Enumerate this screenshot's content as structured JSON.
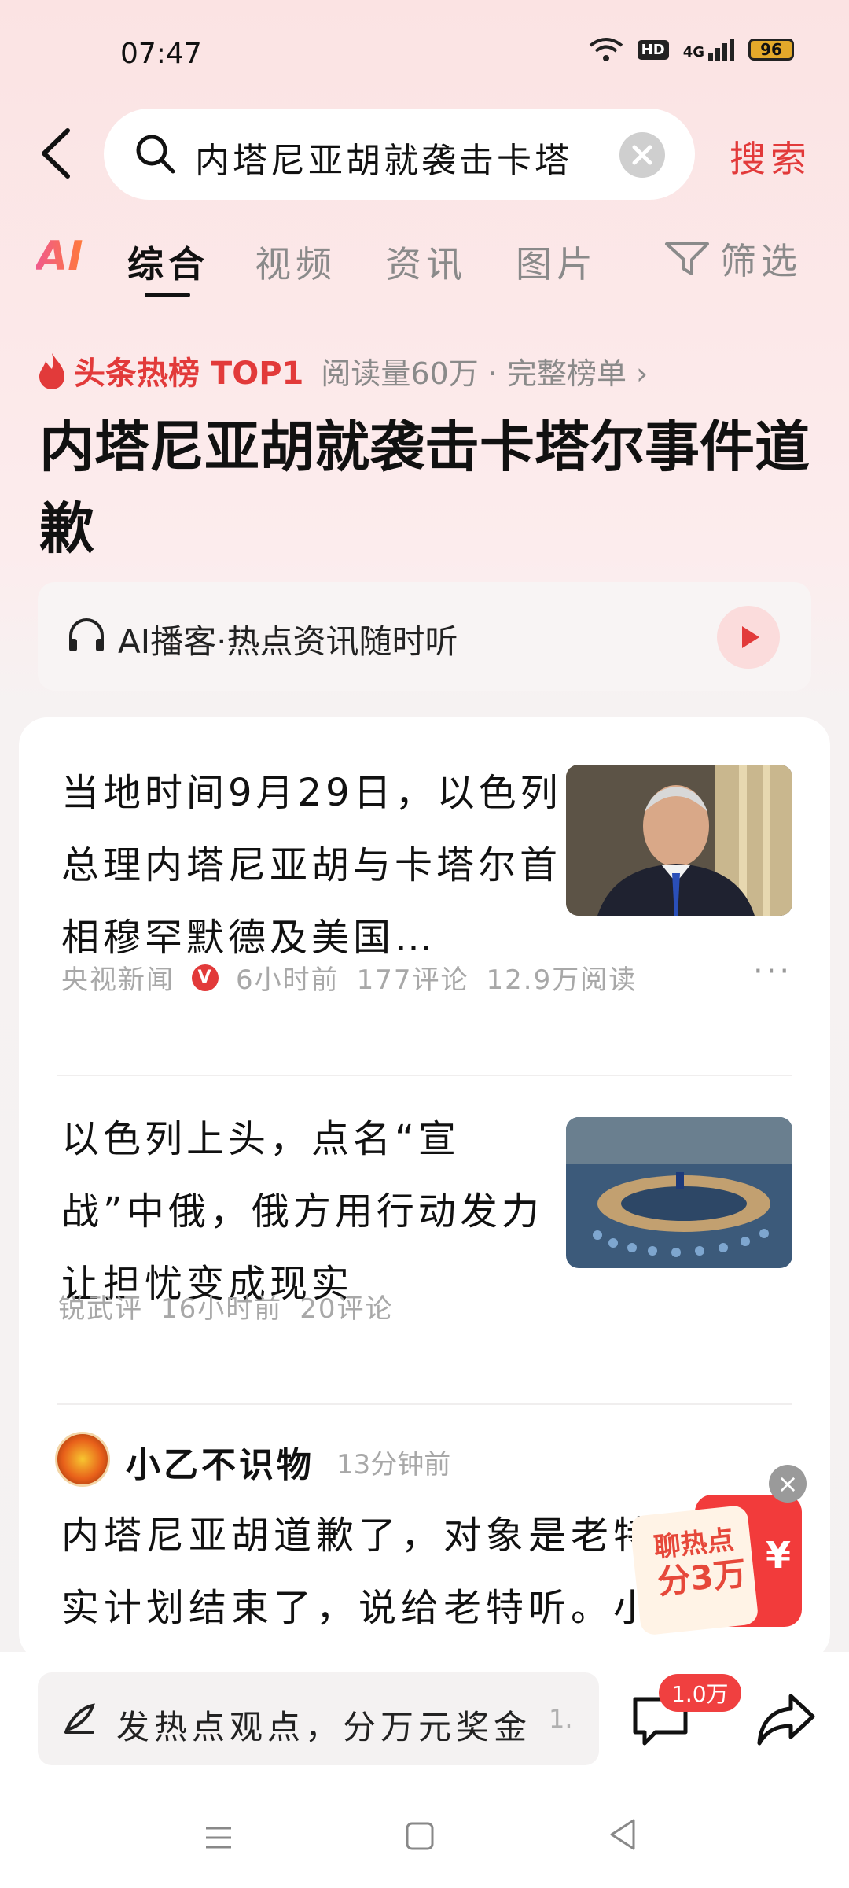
{
  "status_bar": {
    "time": "07:47",
    "network": "HD",
    "signal": "4G",
    "battery": "96"
  },
  "search": {
    "query": "内塔尼亚胡就袭击卡塔",
    "button_label": "搜索"
  },
  "tabs": {
    "ai": "AI",
    "items": [
      "综合",
      "视频",
      "资讯",
      "图片"
    ],
    "active": "综合",
    "filter_label": "筛选"
  },
  "hot": {
    "badge": "头条热榜 TOP1",
    "meta": "阅读量60万 · 完整榜单 ›",
    "headline": "内塔尼亚胡就袭击卡塔尔事件道歉"
  },
  "podcast": {
    "label": "AI播客·热点资讯随时听"
  },
  "articles": [
    {
      "title": "当地时间9月29日，以色列总理内塔尼亚胡与卡塔尔首相穆罕默德及美国…",
      "source": "央视新闻",
      "time": "6小时前",
      "comments": "177评论",
      "reads": "12.9万阅读",
      "more": "···"
    },
    {
      "title": "以色列上头，点名“宣战”中俄，俄方用行动发力让担忧变成现实",
      "source": "锐武评",
      "time": "16小时前",
      "comments": "20评论"
    }
  ],
  "post": {
    "author": "小乙不识物",
    "time": "13分钟前",
    "line1": "内塔尼亚胡道歉了，对象是老特",
    "line2": "实计划结束了，说给老特听。小胡前"
  },
  "promo": {
    "line1": "聊热点",
    "line2": "分3万",
    "symbol": "¥",
    "close": "×"
  },
  "bottom": {
    "comment_placeholder": "发热点观点，分万元奖金",
    "comment_more": "1.",
    "comment_count": "1.0万"
  },
  "colors": {
    "accent": "#e23a3a",
    "muted": "#8a8a8a"
  }
}
